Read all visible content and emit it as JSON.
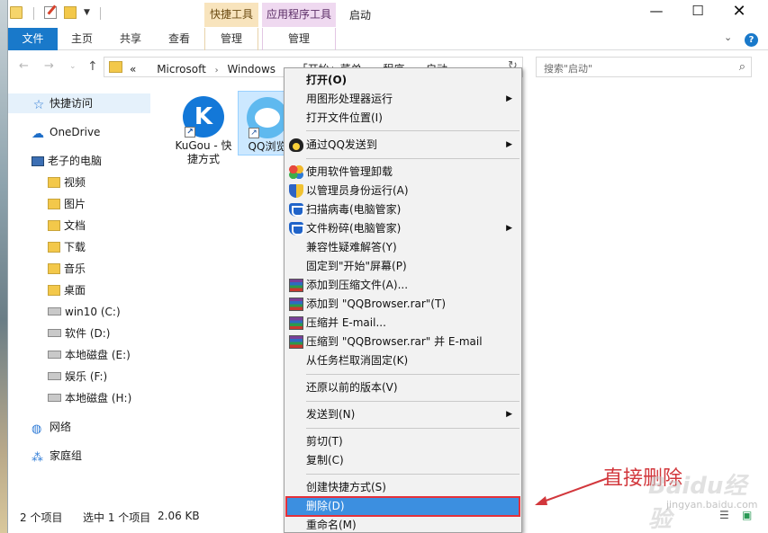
{
  "titlebar": {
    "context_tab_shortcut": "快捷工具",
    "context_tab_app": "应用程序工具",
    "title": "启动",
    "minimize": "—",
    "maximize": "☐",
    "close": "✕"
  },
  "ribbon": {
    "tabs": [
      "文件",
      "主页",
      "共享",
      "查看",
      "管理",
      "管理"
    ],
    "help": "?"
  },
  "address": {
    "prefix": "«",
    "path": [
      "Microsoft",
      "Windows",
      "「开始」菜单",
      "程序",
      "启动"
    ],
    "search_placeholder": "搜索\"启动\""
  },
  "nav": {
    "items": [
      {
        "label": "快捷访问",
        "icon": "star-icon"
      },
      {
        "label": "OneDrive",
        "icon": "cloud-icon"
      },
      {
        "label": "老子的电脑",
        "icon": "computer-icon"
      },
      {
        "label": "视频",
        "icon": "video-folder-icon"
      },
      {
        "label": "图片",
        "icon": "pictures-folder-icon"
      },
      {
        "label": "文档",
        "icon": "documents-folder-icon"
      },
      {
        "label": "下载",
        "icon": "downloads-folder-icon"
      },
      {
        "label": "音乐",
        "icon": "music-folder-icon"
      },
      {
        "label": "桌面",
        "icon": "desktop-folder-icon"
      },
      {
        "label": "win10 (C:)",
        "icon": "drive-icon"
      },
      {
        "label": "软件 (D:)",
        "icon": "drive-icon"
      },
      {
        "label": "本地磁盘 (E:)",
        "icon": "drive-icon"
      },
      {
        "label": "娱乐 (F:)",
        "icon": "drive-icon"
      },
      {
        "label": "本地磁盘 (H:)",
        "icon": "drive-icon"
      },
      {
        "label": "网络",
        "icon": "network-icon"
      },
      {
        "label": "家庭组",
        "icon": "homegroup-icon"
      }
    ]
  },
  "files": [
    {
      "name": "KuGou - 快捷方式",
      "icon": "kugou-icon",
      "selected": false
    },
    {
      "name": "QQ浏览",
      "icon": "qq-browser-icon",
      "selected": true
    }
  ],
  "status": {
    "count": "2 个项目",
    "selection": "选中 1 个项目",
    "size": "2.06 KB"
  },
  "context_menu": {
    "items": [
      {
        "label": "打开(O)",
        "bold": true
      },
      {
        "label": "用图形处理器运行",
        "submenu": true
      },
      {
        "label": "打开文件位置(I)"
      },
      {
        "label": "通过QQ发送到",
        "submenu": true,
        "icon": "qq-penguin-icon"
      },
      {
        "label": "使用软件管理卸载",
        "icon": "software-manager-icon"
      },
      {
        "label": "以管理员身份运行(A)",
        "icon": "uac-shield-icon"
      },
      {
        "label": "扫描病毒(电脑管家)",
        "icon": "pc-manager-icon"
      },
      {
        "label": "文件粉碎(电脑管家)",
        "submenu": true,
        "icon": "pc-manager-icon"
      },
      {
        "label": "兼容性疑难解答(Y)"
      },
      {
        "label": "固定到\"开始\"屏幕(P)"
      },
      {
        "label": "添加到压缩文件(A)...",
        "icon": "winrar-icon"
      },
      {
        "label": "添加到 \"QQBrowser.rar\"(T)",
        "icon": "winrar-icon"
      },
      {
        "label": "压缩并 E-mail...",
        "icon": "winrar-icon"
      },
      {
        "label": "压缩到 \"QQBrowser.rar\" 并 E-mail",
        "icon": "winrar-icon"
      },
      {
        "label": "从任务栏取消固定(K)"
      },
      {
        "label": "还原以前的版本(V)"
      },
      {
        "label": "发送到(N)",
        "submenu": true
      },
      {
        "label": "剪切(T)"
      },
      {
        "label": "复制(C)"
      },
      {
        "label": "创建快捷方式(S)"
      },
      {
        "label": "删除(D)",
        "highlighted": true
      },
      {
        "label": "重命名(M)"
      }
    ]
  },
  "annotation": {
    "text": "直接删除",
    "color": "#d2373c"
  },
  "watermark": {
    "brand": "Baidu经验",
    "url": "jingyan.baidu.com"
  }
}
